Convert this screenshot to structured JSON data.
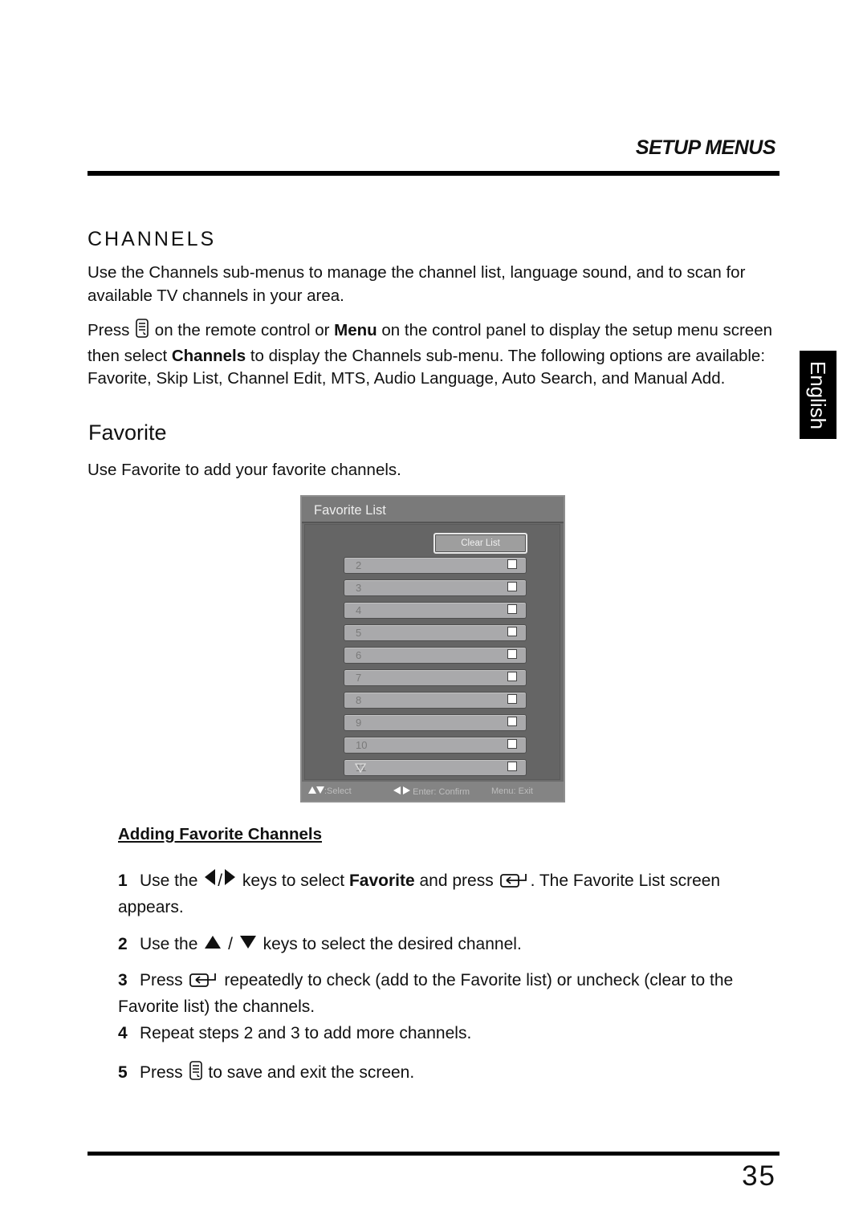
{
  "header": {
    "section": "SETUP MENUS"
  },
  "language_tab": "English",
  "channels": {
    "heading": "CHANNELS",
    "intro": "Use the Channels sub-menus to manage the channel list, language sound, and to scan for available TV channels in your area.",
    "press_para": {
      "t1": "Press",
      "icon": "menu-remote-icon",
      "t2": " on the remote control or ",
      "b1": "Menu",
      "t3": " on the control panel to display the setup menu screen then select ",
      "b2": "Channels",
      "t4": " to display the Channels sub-menu. The following options are available: Favorite, Skip List, Channel Edit, MTS, Audio Language, Auto Search, and Manual Add."
    }
  },
  "favorite": {
    "heading": "Favorite",
    "description": "Use Favorite to add your favorite channels."
  },
  "osd": {
    "title": "Favorite List",
    "clear_button": "Clear List",
    "channels": [
      {
        "number": "2",
        "checked": false
      },
      {
        "number": "3",
        "checked": false
      },
      {
        "number": "4",
        "checked": false
      },
      {
        "number": "5",
        "checked": false
      },
      {
        "number": "6",
        "checked": false
      },
      {
        "number": "7",
        "checked": false
      },
      {
        "number": "8",
        "checked": false
      },
      {
        "number": "9",
        "checked": false
      },
      {
        "number": "10",
        "checked": false
      },
      {
        "number": "11",
        "checked": false
      }
    ],
    "more_indicator": "down-triangle-outline",
    "footer": {
      "select": ":Select",
      "confirm": "Enter: Confirm",
      "exit": "Menu: Exit"
    }
  },
  "adding": {
    "heading": "Adding Favorite Channels",
    "steps": [
      {
        "num": "1",
        "a": "Use the",
        "b": "/",
        "c": " keys to select ",
        "bold": "Favorite",
        "d": " and press ",
        "e": ". The Favorite List screen appears."
      },
      {
        "num": "2",
        "a": "Use the",
        "b": "/",
        "c": " keys to select the desired channel."
      },
      {
        "num": "3",
        "a": "Press",
        "c": " repeatedly to check (add to the Favorite list) or uncheck (clear to the Favorite list) the channels."
      },
      {
        "num": "4",
        "a": "Repeat steps 2 and 3 to add more channels."
      },
      {
        "num": "5",
        "a": "Press",
        "c": " to save and exit the screen."
      }
    ]
  },
  "footer": {
    "page_number": "35"
  }
}
